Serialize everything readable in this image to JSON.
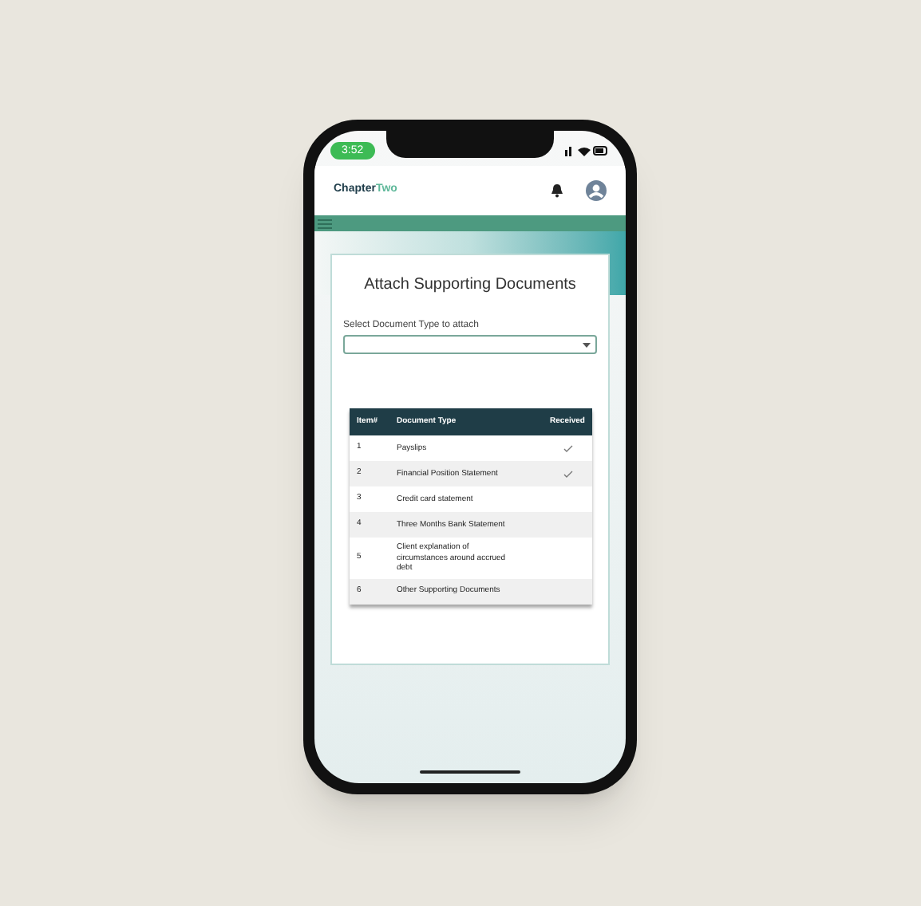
{
  "status_bar": {
    "time": "3:52"
  },
  "header": {
    "logo_main": "Chapter",
    "logo_accent": "Two"
  },
  "page": {
    "title": "Attach Supporting Documents",
    "select_label": "Select Document Type to attach"
  },
  "table": {
    "columns": [
      "Item#",
      "Document Type",
      "Received"
    ],
    "rows": [
      {
        "item": "1",
        "type": "Payslips",
        "received": true
      },
      {
        "item": "2",
        "type": "Financial Position Statement",
        "received": true
      },
      {
        "item": "3",
        "type": "Credit card statement",
        "received": false
      },
      {
        "item": "4",
        "type": "Three Months Bank Statement",
        "received": false
      },
      {
        "item": "5",
        "type": "Client explanation of circumstances around accrued debt",
        "received": false
      },
      {
        "item": "6",
        "type": "Other Supporting Documents",
        "received": false
      }
    ]
  }
}
